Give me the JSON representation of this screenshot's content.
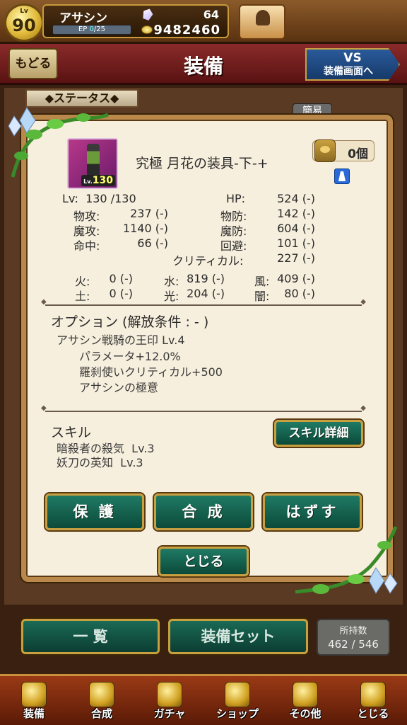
{
  "player": {
    "lv_label": "Lv",
    "level": "90",
    "name": "アサシン",
    "ep_label": "EP",
    "ep_current": "0",
    "ep_max": "/25",
    "gems": "64",
    "gold": "9482460"
  },
  "header": {
    "back_label": "もどる",
    "title": "装備",
    "vs_line1": "VS",
    "vs_line2": "装備画面へ"
  },
  "tabs": {
    "status_label": "◆ステータス◆",
    "simple_label": "簡易"
  },
  "item": {
    "thumb_lv_prefix": "Lv.",
    "thumb_lv": "130",
    "name": "究極 月花の装具-下-+",
    "owned_count": "0個"
  },
  "stats": {
    "lv": "Lv:  130 /130",
    "hp_label": "HP:",
    "hp_value": "524 (-)",
    "patk_label": "物攻:",
    "patk_value": "237 (-)",
    "pdef_label": "物防:",
    "pdef_value": "142 (-)",
    "matk_label": "魔攻:",
    "matk_value": "1140 (-)",
    "mdef_label": "魔防:",
    "mdef_value": "604 (-)",
    "acc_label": "命中:",
    "acc_value": "66 (-)",
    "eva_label": "回避:",
    "eva_value": "101 (-)",
    "crit_label": "クリティカル:",
    "crit_value": "227 (-)",
    "fire_label": "火:",
    "fire_value": "0 (-)",
    "water_label": "水:",
    "water_value": "819 (-)",
    "wind_label": "風:",
    "wind_value": "409 (-)",
    "earth_label": "土:",
    "earth_value": "0 (-)",
    "light_label": "光:",
    "light_value": "204 (-)",
    "dark_label": "闇:",
    "dark_value": "80 (-)"
  },
  "options": {
    "title": "オプション (解放条件 : - )",
    "lines": [
      "アサシン戦騎の王印 Lv.4",
      "パラメータ+12.0%",
      "羅刹使いクリティカル+500",
      "アサシンの極意"
    ]
  },
  "skills": {
    "title": "スキル",
    "detail_button": "スキル詳細",
    "lines": [
      "暗殺者の殺気  Lv.3",
      "妖刀の英知  Lv.3"
    ]
  },
  "actions": {
    "protect": "保 護",
    "synth": "合 成",
    "remove": "はずす",
    "close": "とじる"
  },
  "lower": {
    "list": "一 覧",
    "equip_set": "装備セット",
    "hold_label": "所持数",
    "hold_value": "462 / 546"
  },
  "nav": [
    {
      "label": "装備",
      "icon": "equipment-icon"
    },
    {
      "label": "合成",
      "icon": "hammer-icon"
    },
    {
      "label": "ガチャ",
      "icon": "gacha-cards-icon"
    },
    {
      "label": "ショップ",
      "icon": "crystal-shop-icon"
    },
    {
      "label": "その他",
      "icon": "gear-icon"
    },
    {
      "label": "とじる",
      "icon": "guardian-statue-icon"
    }
  ]
}
